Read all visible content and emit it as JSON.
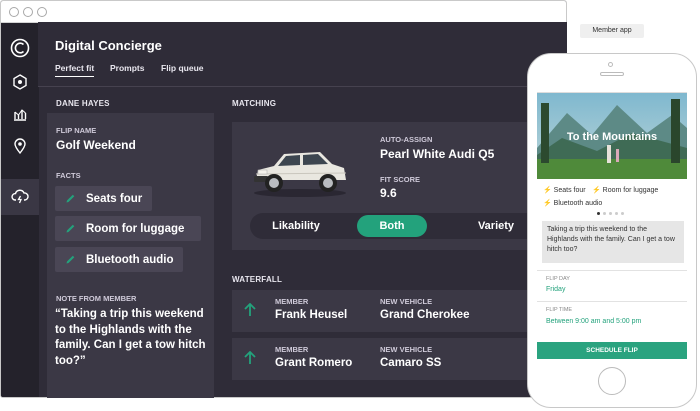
{
  "app": {
    "title": "Digital Concierge",
    "tabs": [
      "Perfect fit",
      "Prompts",
      "Flip queue"
    ],
    "active_tab": "Perfect fit"
  },
  "sidebar_icons": [
    "logo-icon",
    "hexagon-icon",
    "chart-icon",
    "location-pin-icon",
    "cloud-lightning-icon"
  ],
  "member": {
    "name": "DANE HAYES",
    "flip_name_label": "FLIP NAME",
    "flip_name": "Golf Weekend",
    "facts_label": "FACTS",
    "facts": [
      "Seats four",
      "Room for luggage",
      "Bluetooth audio"
    ],
    "note_label": "NOTE FROM MEMBER",
    "note": "“Taking a trip this weekend to the Highlands with the family. Can I get a tow hitch too?”"
  },
  "matching": {
    "section_label": "MATCHING",
    "auto_assign_label": "AUTO-ASSIGN",
    "vehicle": "Pearl White Audi Q5",
    "fit_score_label": "FIT SCORE",
    "fit_score": "9.6",
    "toggle": [
      "Likability",
      "Both",
      "Variety"
    ],
    "toggle_selected": "Both"
  },
  "waterfall": {
    "section_label": "WATERFALL",
    "member_label": "MEMBER",
    "vehicle_label": "NEW VEHICLE",
    "rows": [
      {
        "member": "Frank Heusel",
        "vehicle": "Grand Cherokee"
      },
      {
        "member": "Grant Romero",
        "vehicle": "Camaro SS"
      }
    ]
  },
  "member_app": {
    "tag": "Member app",
    "hero_title": "To the Mountains",
    "facts": [
      "Seats four",
      "Room for luggage",
      "Bluetooth audio"
    ],
    "note": "Taking a trip this weekend to the Highlands with the family. Can I get a tow hitch too?",
    "flip_day_label": "FLIP DAY",
    "flip_day": "Friday",
    "flip_time_label": "FLIP TIME",
    "flip_time": "Between 9:00 am and 5:00 pm",
    "cta": "SCHEDULE FLIP"
  },
  "colors": {
    "accent": "#23a27c",
    "bg": "#2f2c38",
    "panel": "#3b3845",
    "rail": "#24222b"
  }
}
